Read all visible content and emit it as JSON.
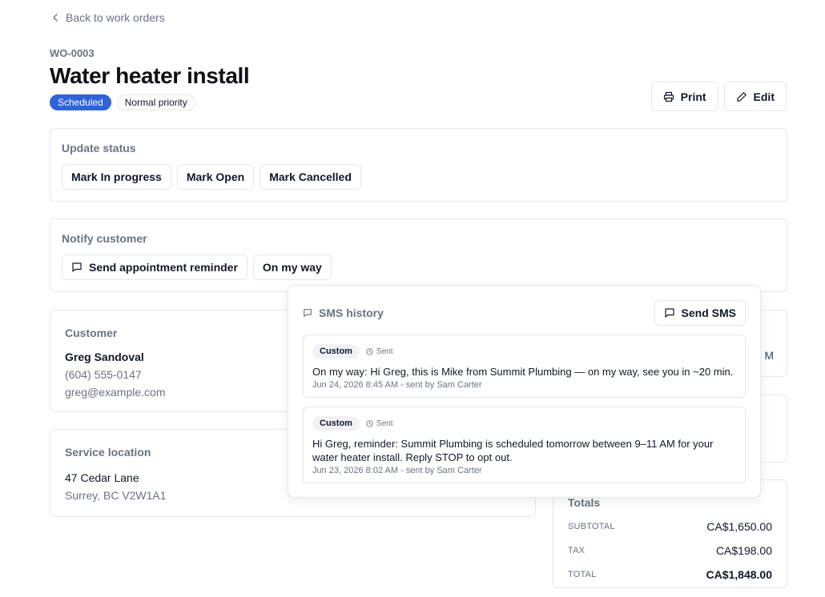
{
  "nav": {
    "back_label": "Back to work orders"
  },
  "order": {
    "id": "WO-0003",
    "title": "Water heater install",
    "status_badge": "Scheduled",
    "priority_badge": "Normal priority"
  },
  "actions": {
    "print_label": "Print",
    "edit_label": "Edit"
  },
  "status_section": {
    "title": "Update status",
    "buttons": [
      "Mark In progress",
      "Mark Open",
      "Mark Cancelled"
    ]
  },
  "notify_section": {
    "title": "Notify customer",
    "reminder_label": "Send appointment reminder",
    "on_my_way_label": "On my way"
  },
  "customer": {
    "title": "Customer",
    "name": "Greg Sandoval",
    "phone": "(604) 555-0147",
    "email": "greg@example.com"
  },
  "location": {
    "title": "Service location",
    "line1": "47 Cedar Lane",
    "line2": "Surrey, BC V2W1A1"
  },
  "side_card": {
    "clipped_text": "M"
  },
  "totals": {
    "title": "Totals",
    "subtotal_label": "SUBTOTAL",
    "subtotal": "CA$1,650.00",
    "tax_label": "TAX",
    "tax": "CA$198.00",
    "total_label": "TOTAL",
    "total": "CA$1,848.00"
  },
  "sms": {
    "title": "SMS history",
    "send_label": "Send SMS",
    "messages": [
      {
        "tag": "Custom",
        "status": "Sent",
        "body": "On my way: Hi Greg, this is Mike from Summit Plumbing — on my way, see you in ~20 min.",
        "meta": "Jun 24, 2026 8:45 AM - sent by Sam Carter"
      },
      {
        "tag": "Custom",
        "status": "Sent",
        "body": "Hi Greg, reminder: Summit Plumbing is scheduled tomorrow between 9–11 AM for your water heater install. Reply STOP to opt out.",
        "meta": "Jun 23, 2026 8:02 AM - sent by Sam Carter"
      }
    ]
  },
  "colors": {
    "primary": "#2f63d8",
    "muted_text": "#6b7280",
    "border": "#e5e7eb"
  }
}
